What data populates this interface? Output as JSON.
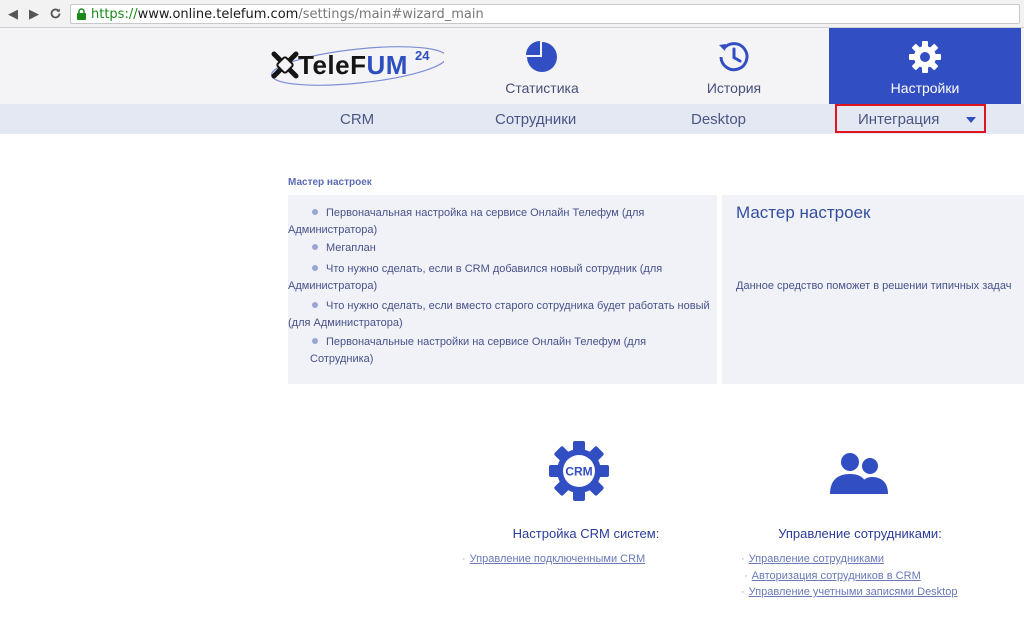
{
  "browser": {
    "url_scheme": "https://",
    "url_host": "www.online.telefum.com",
    "url_path": "/settings/main#wizard_main"
  },
  "header": {
    "logo_main": "TeleF",
    "logo_um": "UM",
    "logo_sup": "24",
    "tabs": [
      {
        "label": "Статистика",
        "icon": "pie-chart-icon",
        "active": false
      },
      {
        "label": "История",
        "icon": "history-icon",
        "active": false
      },
      {
        "label": "Настройки",
        "icon": "gear-icon",
        "active": true
      }
    ],
    "accent_color": "#324ec3"
  },
  "subnav": {
    "items": [
      "CRM",
      "Сотрудники",
      "Desktop",
      "Интеграция"
    ],
    "highlight_color": "#e0141e"
  },
  "wizard": {
    "caption": "Мастер настроек",
    "items": [
      {
        "line1": "Первоначальная настройка на сервисе Онлайн Телефум (для",
        "line2": "Администратора)"
      },
      {
        "line1": "Мегаплан",
        "line2": ""
      },
      {
        "line1": "Что нужно сделать, если в CRM добавился новый сотрудник (для",
        "line2": "Администратора)"
      },
      {
        "line1": "Что нужно сделать, если вместо старого сотрудника будет работать новый",
        "line2": "(для Администратора)"
      },
      {
        "line1": "Первоначальные настройки на сервисе Онлайн Телефум (для Сотрудника)",
        "line2": ""
      }
    ],
    "info_title": "Мастер настроек",
    "info_text": "Данное средство поможет в решении типичных задач"
  },
  "crm_block": {
    "icon": "crm-gear-icon",
    "icon_text": "CRM",
    "title": "Настройка CRM систем:",
    "links": [
      "Управление подключенными CRM"
    ]
  },
  "staff_block": {
    "icon": "users-icon",
    "title": "Управление сотрудниками:",
    "links": [
      "Управление сотрудниками",
      "Авторизация сотрудников в CRM",
      "Управление учетными записями Desktop"
    ]
  }
}
